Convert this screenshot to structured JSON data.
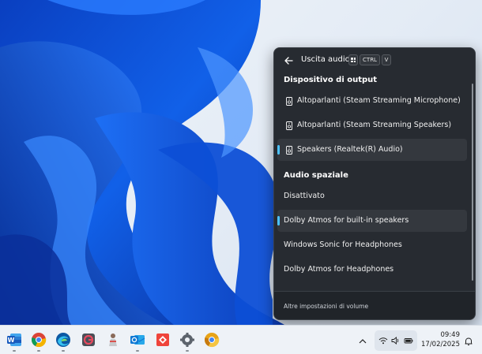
{
  "panel": {
    "title": "Uscita audio",
    "shortcut": {
      "key1_icon": "windows-key-icon",
      "key2": "CTRL",
      "key3": "V"
    },
    "output_section_title": "Dispositivo di output",
    "output_devices": [
      {
        "label": "Altoparlanti (Steam Streaming Microphone)",
        "icon": "speaker-icon",
        "selected": false
      },
      {
        "label": "Altoparlanti (Steam Streaming Speakers)",
        "icon": "speaker-icon",
        "selected": false
      },
      {
        "label": "Speakers (Realtek(R) Audio)",
        "icon": "speaker-icon",
        "selected": true
      }
    ],
    "spatial_section_title": "Audio spaziale",
    "spatial_options": [
      {
        "label": "Disattivato",
        "selected": false
      },
      {
        "label": "Dolby Atmos for built-in speakers",
        "selected": true
      },
      {
        "label": "Windows Sonic for Headphones",
        "selected": false
      },
      {
        "label": "Dolby Atmos for Headphones",
        "selected": false
      }
    ],
    "footer_link": "Altre impostazioni di volume",
    "accent_color": "#4cc2ff"
  },
  "taskbar": {
    "apps": [
      "word-icon",
      "chrome-icon",
      "edge-icon",
      "app-icon-red-g",
      "app-icon-figure",
      "outlook-icon",
      "anydesk-icon",
      "settings-gear-icon",
      "chrome-canary-icon"
    ],
    "tray_icons": [
      "chevron-up-icon",
      "wifi-icon",
      "volume-icon",
      "battery-icon",
      "notification-bell-icon"
    ],
    "time": "09:49",
    "date": "17/02/2025"
  }
}
